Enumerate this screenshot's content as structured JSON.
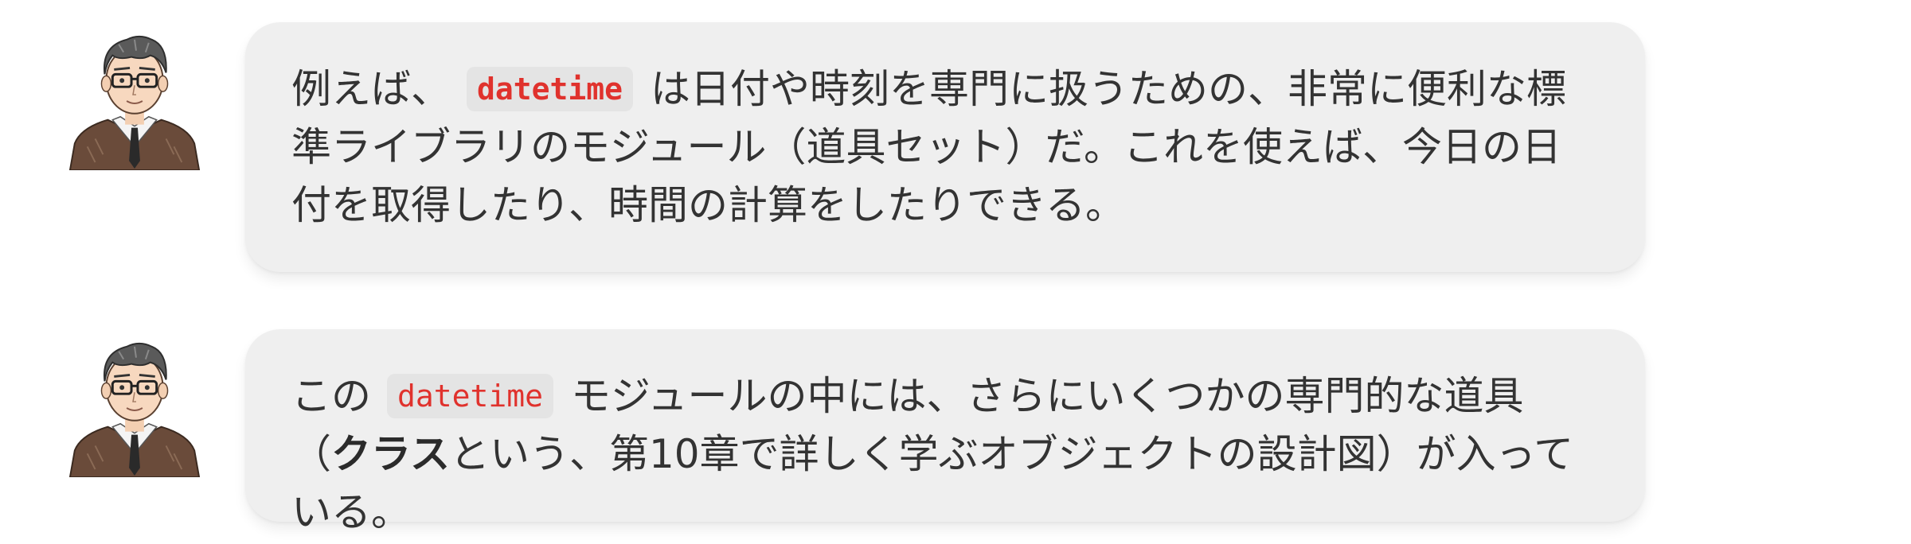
{
  "messages": [
    {
      "avatar_icon": "teacher-avatar-icon",
      "before": "例えば、",
      "code": "datetime",
      "after": "は日付や時刻を専門に扱うための、非常に便利な標準ライブラリのモジュール（道具セット）だ。これを使えば、今日の日付を取得したり、時間の計算をしたりできる。"
    },
    {
      "avatar_icon": "teacher-avatar-icon",
      "before": "この",
      "code": "datetime",
      "after_1": "モジュールの中には、さらにいくつかの専門的な道具（",
      "bold": "クラス",
      "after_2": "という、第10章で詳しく学ぶオブジェクトの設計図）が入っている。"
    }
  ],
  "colors": {
    "bubble_bg": "#efefef",
    "code_bg": "#e4e4e4",
    "code_text": "#e0322d",
    "body_text": "#333333"
  }
}
